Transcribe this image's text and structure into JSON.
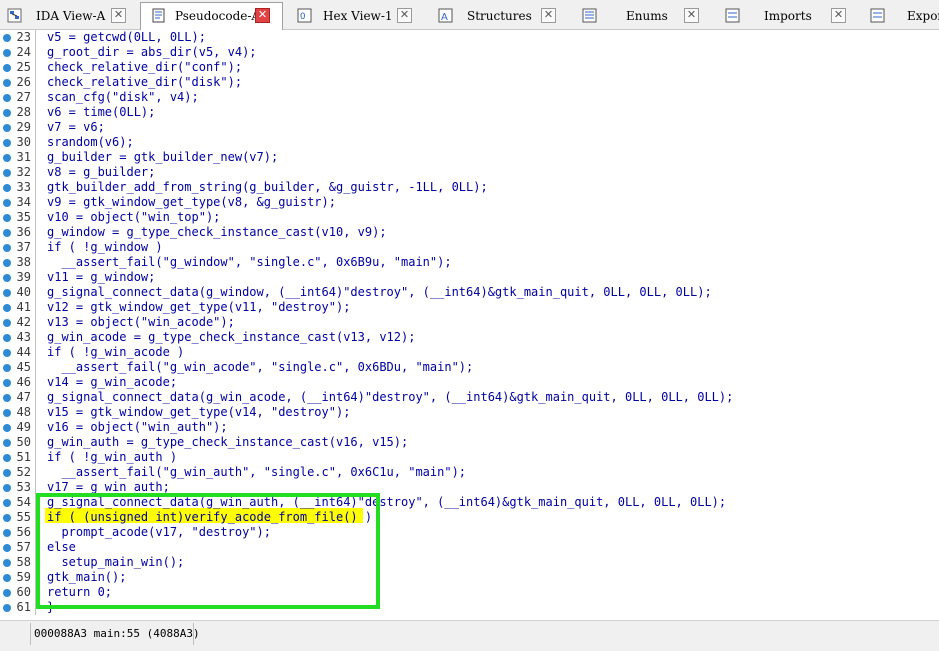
{
  "tabs": [
    {
      "label": "IDA View-A",
      "active": false,
      "icon": "graph-icon"
    },
    {
      "label": "Pseudocode-A",
      "active": true,
      "icon": "document-icon"
    },
    {
      "label": "Hex View-1",
      "active": false,
      "icon": "hex-icon"
    },
    {
      "label": "Structures",
      "active": false,
      "icon": "struct-icon"
    },
    {
      "label": "Enums",
      "active": false,
      "icon": "enum-icon"
    },
    {
      "label": "Imports",
      "active": false,
      "icon": "import-icon"
    },
    {
      "label": "Expor",
      "active": false,
      "icon": "export-icon"
    }
  ],
  "lines": [
    {
      "n": "23",
      "text": "v5 = getcwd(0LL, 0LL);"
    },
    {
      "n": "24",
      "text": "g_root_dir = abs_dir(v5, v4);"
    },
    {
      "n": "25",
      "text": "check_relative_dir(\"conf\");"
    },
    {
      "n": "26",
      "text": "check_relative_dir(\"disk\");"
    },
    {
      "n": "27",
      "text": "scan_cfg(\"disk\", v4);"
    },
    {
      "n": "28",
      "text": "v6 = time(0LL);"
    },
    {
      "n": "29",
      "text": "v7 = v6;"
    },
    {
      "n": "30",
      "text": "srandom(v6);"
    },
    {
      "n": "31",
      "text": "g_builder = gtk_builder_new(v7);"
    },
    {
      "n": "32",
      "text": "v8 = g_builder;"
    },
    {
      "n": "33",
      "text": "gtk_builder_add_from_string(g_builder, &g_guistr, -1LL, 0LL);"
    },
    {
      "n": "34",
      "text": "v9 = gtk_window_get_type(v8, &g_guistr);"
    },
    {
      "n": "35",
      "text": "v10 = object(\"win_top\");"
    },
    {
      "n": "36",
      "text": "g_window = g_type_check_instance_cast(v10, v9);"
    },
    {
      "n": "37",
      "text": "if ( !g_window )"
    },
    {
      "n": "38",
      "text": "  __assert_fail(\"g_window\", \"single.c\", 0x6B9u, \"main\");"
    },
    {
      "n": "39",
      "text": "v11 = g_window;"
    },
    {
      "n": "40",
      "text": "g_signal_connect_data(g_window, (__int64)\"destroy\", (__int64)&gtk_main_quit, 0LL, 0LL, 0LL);"
    },
    {
      "n": "41",
      "text": "v12 = gtk_window_get_type(v11, \"destroy\");"
    },
    {
      "n": "42",
      "text": "v13 = object(\"win_acode\");"
    },
    {
      "n": "43",
      "text": "g_win_acode = g_type_check_instance_cast(v13, v12);"
    },
    {
      "n": "44",
      "text": "if ( !g_win_acode )"
    },
    {
      "n": "45",
      "text": "  __assert_fail(\"g_win_acode\", \"single.c\", 0x6BDu, \"main\");"
    },
    {
      "n": "46",
      "text": "v14 = g_win_acode;"
    },
    {
      "n": "47",
      "text": "g_signal_connect_data(g_win_acode, (__int64)\"destroy\", (__int64)&gtk_main_quit, 0LL, 0LL, 0LL);"
    },
    {
      "n": "48",
      "text": "v15 = gtk_window_get_type(v14, \"destroy\");"
    },
    {
      "n": "49",
      "text": "v16 = object(\"win_auth\");"
    },
    {
      "n": "50",
      "text": "g_win_auth = g_type_check_instance_cast(v16, v15);"
    },
    {
      "n": "51",
      "text": "if ( !g_win_auth )"
    },
    {
      "n": "52",
      "text": "  __assert_fail(\"g_win_auth\", \"single.c\", 0x6C1u, \"main\");"
    },
    {
      "n": "53",
      "text": "v17 = g_win_auth;"
    },
    {
      "n": "54",
      "text": "g_signal_connect_data(g_win_auth, (__int64)\"destroy\", (__int64)&gtk_main_quit, 0LL, 0LL, 0LL);"
    },
    {
      "n": "55",
      "text": "if ( (unsigned int)verify_acode_from_file() )"
    },
    {
      "n": "56",
      "text": "  prompt_acode(v17, \"destroy\");"
    },
    {
      "n": "57",
      "text": "else"
    },
    {
      "n": "58",
      "text": "  setup_main_win();"
    },
    {
      "n": "59",
      "text": "gtk_main();"
    },
    {
      "n": "60",
      "text": "return 0;"
    },
    {
      "n": "61",
      "text": "}"
    }
  ],
  "status": {
    "text": "000088A3 main:55 (4088A3)"
  },
  "colors": {
    "code_text": "#0000a0",
    "highlight": "#ffff00",
    "annotation_box": "#22dd22",
    "breakpoint_dot": "#2f8ad6"
  }
}
